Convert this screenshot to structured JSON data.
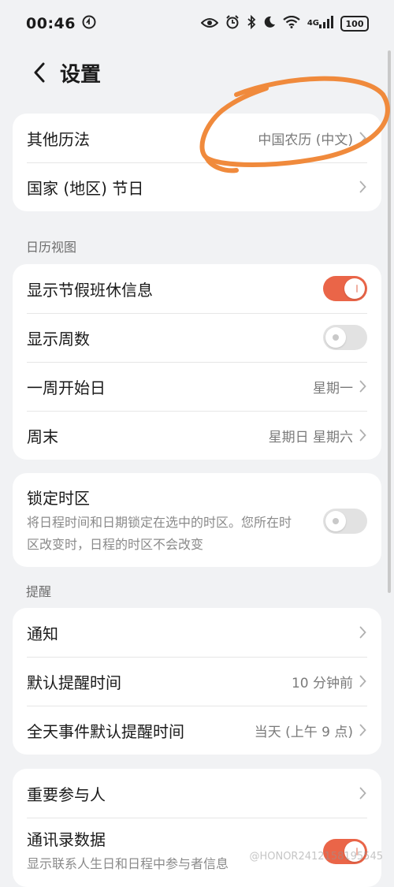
{
  "status_bar": {
    "time": "00:46",
    "network": "4G",
    "battery": "100"
  },
  "header": {
    "title": "设置"
  },
  "other_calendars": {
    "label": "其他历法",
    "value": "中国农历 (中文)"
  },
  "holidays": {
    "label": "国家 (地区) 节日"
  },
  "calendar_view": {
    "section_title": "日历视图",
    "show_holidays": {
      "label": "显示节假班休信息",
      "on": true
    },
    "show_week_numbers": {
      "label": "显示周数",
      "on": false
    },
    "week_start": {
      "label": "一周开始日",
      "value": "星期一"
    },
    "weekend": {
      "label": "周末",
      "value": "星期日 星期六"
    }
  },
  "lock_timezone": {
    "label": "锁定时区",
    "description": "将日程时间和日期锁定在选中的时区。您所在时区改变时，日程的时区不会改变",
    "on": false
  },
  "reminders": {
    "section_title": "提醒",
    "notifications": {
      "label": "通知"
    },
    "default_reminder": {
      "label": "默认提醒时间",
      "value": "10 分钟前"
    },
    "allday_reminder": {
      "label": "全天事件默认提醒时间",
      "value": "当天 (上午 9 点)"
    }
  },
  "important_participants": {
    "label": "重要参与人"
  },
  "contacts_data": {
    "label": "通讯录数据",
    "description": "显示联系人生日和日程中参与者信息",
    "on": true
  },
  "watermark": "@HONOR2412158195545",
  "colors": {
    "accent": "#ea6548",
    "annotation": "#f08a3c",
    "background": "#f1f2f4"
  }
}
